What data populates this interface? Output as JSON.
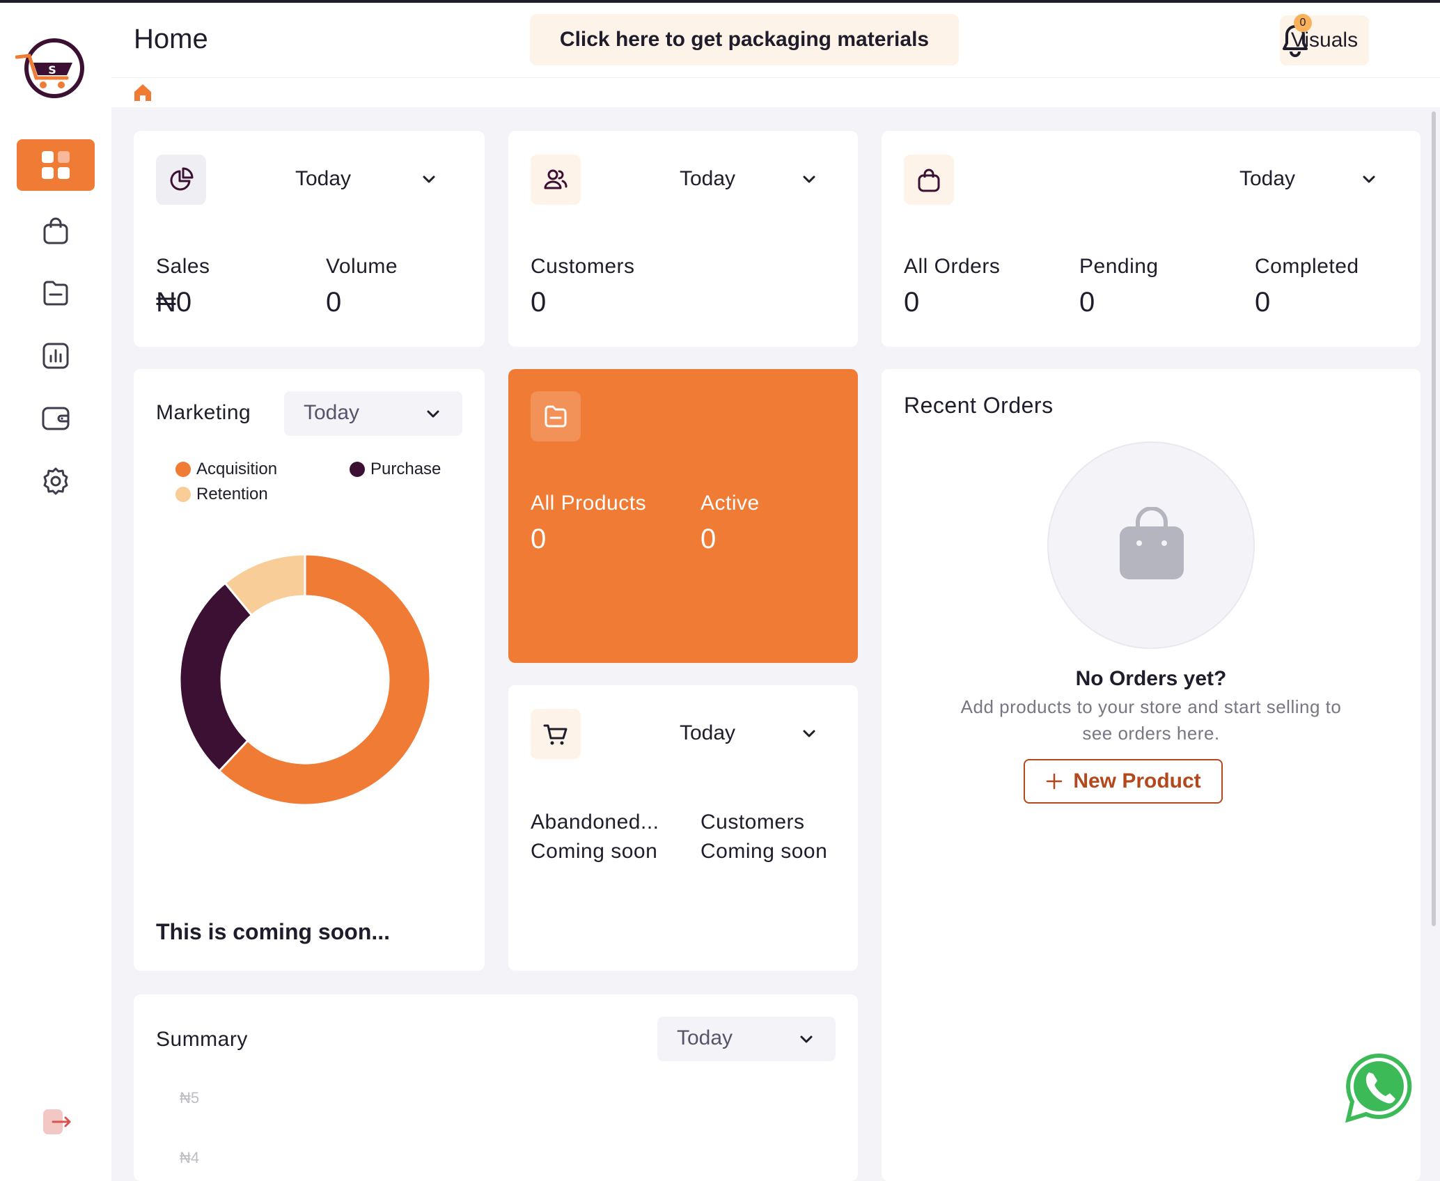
{
  "header": {
    "title": "Home",
    "packaging_button": "Click here to get packaging materials",
    "visuals_button": "Visuals",
    "notification_count": "0"
  },
  "sidebar": {
    "items": [
      {
        "name": "dashboard",
        "active": true
      },
      {
        "name": "orders"
      },
      {
        "name": "products"
      },
      {
        "name": "analytics"
      },
      {
        "name": "wallet"
      },
      {
        "name": "settings"
      },
      {
        "name": "logout"
      }
    ]
  },
  "sales_card": {
    "period": "Today",
    "sales_label": "Sales",
    "sales_value": "₦0",
    "volume_label": "Volume",
    "volume_value": "0"
  },
  "customers_card": {
    "period": "Today",
    "label": "Customers",
    "value": "0"
  },
  "orders_card": {
    "period": "Today",
    "all_label": "All Orders",
    "all_value": "0",
    "pending_label": "Pending",
    "pending_value": "0",
    "completed_label": "Completed",
    "completed_value": "0"
  },
  "marketing_card": {
    "title": "Marketing",
    "period": "Today",
    "coming_soon": "This is coming soon...",
    "legend": [
      {
        "label": "Acquisition",
        "color": "#f07b35"
      },
      {
        "label": "Purchase",
        "color": "#3b1033"
      },
      {
        "label": "Retention",
        "color": "#f8cd98"
      }
    ]
  },
  "chart_data": {
    "type": "pie",
    "categories": [
      "Acquisition",
      "Purchase",
      "Retention"
    ],
    "values": [
      62,
      27,
      11
    ],
    "colors": [
      "#f07b35",
      "#3b1033",
      "#f8cd98"
    ],
    "title": "",
    "legend_position": "top"
  },
  "products_card": {
    "all_label": "All Products",
    "all_value": "0",
    "active_label": "Active",
    "active_value": "0"
  },
  "cart_card": {
    "period": "Today",
    "abandoned_label": "Abandoned...",
    "abandoned_value": "Coming soon",
    "customers_label": "Customers",
    "customers_value": "Coming soon"
  },
  "recent_orders": {
    "title": "Recent Orders",
    "empty_title": "No Orders yet?",
    "empty_text_line1": "Add products to your store and start selling to",
    "empty_text_line2": "see orders here.",
    "new_product_button": "New Product"
  },
  "summary_card": {
    "title": "Summary",
    "period": "Today",
    "y_ticks": [
      "₦5",
      "₦4"
    ]
  },
  "colors": {
    "accent": "#f07b35",
    "dark": "#3b1033",
    "light_accent": "#fdf3e8",
    "background": "#f4f4f8"
  }
}
